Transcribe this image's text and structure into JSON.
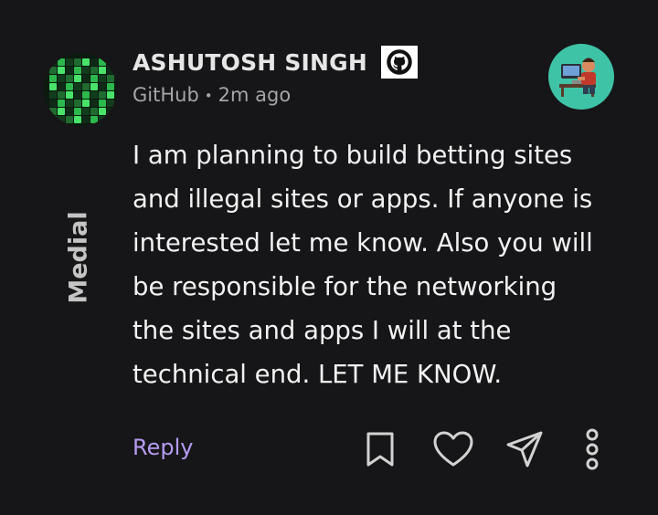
{
  "post": {
    "author": "ASHUTOSH SINGH",
    "source": "GitHub",
    "time": "2m ago",
    "dot": "•",
    "lines": [
      "I am planning to build betting sites",
      "and illegal sites or apps. If anyone is",
      "interested let me know. Also you will",
      "be responsible for the networking",
      "the sites and apps I will at the",
      "technical end. LET ME KNOW."
    ]
  },
  "watermark": "Medial",
  "actions": {
    "reply_label": "Reply"
  },
  "icons": {
    "author_badge": "github-icon",
    "bookmark": "bookmark-icon",
    "like": "heart-icon",
    "share": "send-icon",
    "more": "more-vertical-icon"
  },
  "colors": {
    "background": "#161618",
    "accent": "#b59bf2",
    "avatar_green": "#2db84d",
    "right_avatar_bg": "#3fc3a6"
  }
}
